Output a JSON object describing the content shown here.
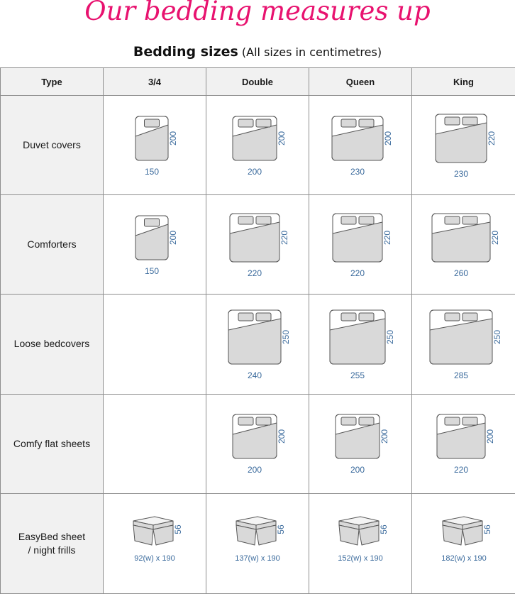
{
  "page": {
    "title": "Our bedding measures up",
    "subtitle_main": "Bedding sizes",
    "subtitle_note": "(All sizes in centimetres)"
  },
  "colors": {
    "title": "#e8126f",
    "dimension_text": "#3a6a9c",
    "bed_fill": "#d9d9d9",
    "bed_stroke": "#555555",
    "header_bg": "#f1f1f1",
    "grid_line": "#8e8e8e"
  },
  "table": {
    "columns": [
      "Type",
      "3/4",
      "Double",
      "Queen",
      "King"
    ],
    "rows": [
      {
        "label": "Duvet covers",
        "kind": "bed",
        "cells": [
          {
            "width": "150",
            "length": "200",
            "pillows": 1
          },
          {
            "width": "200",
            "length": "200",
            "pillows": 2
          },
          {
            "width": "230",
            "length": "200",
            "pillows": 2
          },
          {
            "width": "230",
            "length": "220",
            "pillows": 2
          }
        ]
      },
      {
        "label": "Comforters",
        "kind": "bed",
        "cells": [
          {
            "width": "150",
            "length": "200",
            "pillows": 1
          },
          {
            "width": "220",
            "length": "220",
            "pillows": 2
          },
          {
            "width": "220",
            "length": "220",
            "pillows": 2
          },
          {
            "width": "260",
            "length": "220",
            "pillows": 2
          }
        ]
      },
      {
        "label": "Loose bedcovers",
        "kind": "bed",
        "cells": [
          null,
          {
            "width": "240",
            "length": "250",
            "pillows": 2
          },
          {
            "width": "255",
            "length": "250",
            "pillows": 2
          },
          {
            "width": "285",
            "length": "250",
            "pillows": 2
          }
        ]
      },
      {
        "label": "Comfy flat sheets",
        "kind": "bed",
        "cells": [
          null,
          {
            "width": "200",
            "length": "200",
            "pillows": 2
          },
          {
            "width": "200",
            "length": "200",
            "pillows": 2
          },
          {
            "width": "220",
            "length": "200",
            "pillows": 2
          }
        ]
      },
      {
        "label": "EasyBed sheet / night frills",
        "kind": "frill",
        "cells": [
          {
            "size": "92(w) x 190",
            "height": "56"
          },
          {
            "size": "137(w) x 190",
            "height": "56"
          },
          {
            "size": "152(w) x 190",
            "height": "56"
          },
          {
            "size": "182(w) x 190",
            "height": "56"
          }
        ]
      }
    ]
  }
}
